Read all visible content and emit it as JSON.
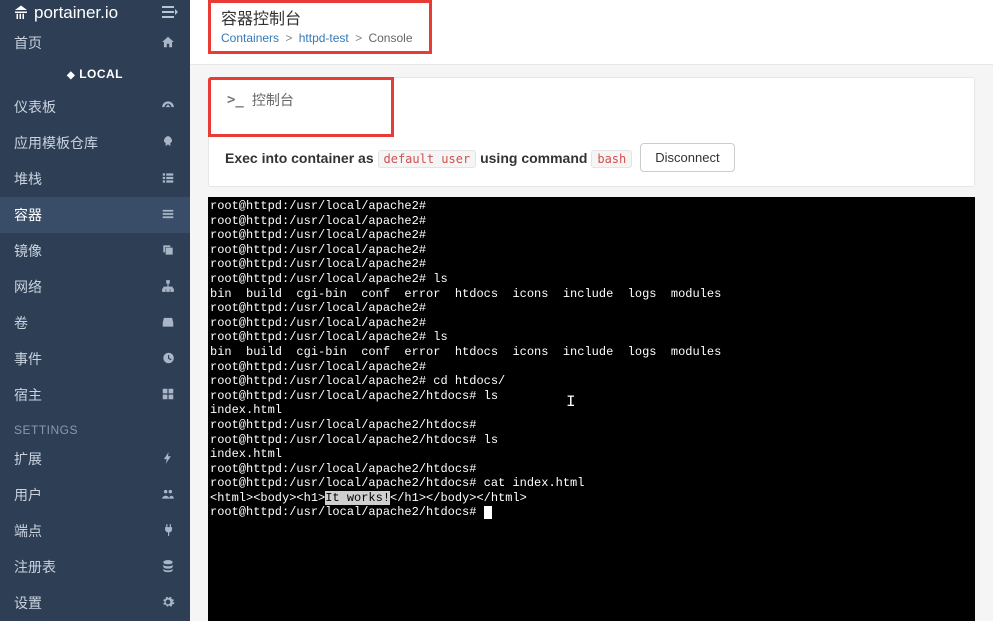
{
  "brand": "portainer.io",
  "env_label": "LOCAL",
  "settings_heading": "SETTINGS",
  "sidebar": {
    "home": "首页",
    "items_top": [
      {
        "label": "仪表板",
        "icon": "tachometer"
      },
      {
        "label": "应用模板仓库",
        "icon": "rocket"
      },
      {
        "label": "堆栈",
        "icon": "th-list"
      },
      {
        "label": "容器",
        "icon": "bars",
        "active": true
      },
      {
        "label": "镜像",
        "icon": "clone"
      },
      {
        "label": "网络",
        "icon": "sitemap"
      },
      {
        "label": "卷",
        "icon": "hdd"
      },
      {
        "label": "事件",
        "icon": "history"
      },
      {
        "label": "宿主",
        "icon": "th"
      }
    ],
    "items_settings": [
      {
        "label": "扩展",
        "icon": "bolt"
      },
      {
        "label": "用户",
        "icon": "users"
      },
      {
        "label": "端点",
        "icon": "plug"
      },
      {
        "label": "注册表",
        "icon": "database"
      },
      {
        "label": "设置",
        "icon": "cog"
      }
    ]
  },
  "header": {
    "title": "容器控制台",
    "crumbs": {
      "a": "Containers",
      "b": "httpd-test",
      "c": "Console"
    }
  },
  "panel": {
    "head": "控制台",
    "exec_pre": "Exec into container as",
    "exec_user": "default user",
    "exec_mid": "using command",
    "exec_cmd": "bash",
    "disconnect": "Disconnect"
  },
  "terminal_lines": [
    "root@httpd:/usr/local/apache2#",
    "root@httpd:/usr/local/apache2#",
    "root@httpd:/usr/local/apache2#",
    "root@httpd:/usr/local/apache2#",
    "root@httpd:/usr/local/apache2#",
    "root@httpd:/usr/local/apache2# ls",
    "bin  build  cgi-bin  conf  error  htdocs  icons  include  logs  modules",
    "root@httpd:/usr/local/apache2#",
    "root@httpd:/usr/local/apache2#",
    "root@httpd:/usr/local/apache2# ls",
    "bin  build  cgi-bin  conf  error  htdocs  icons  include  logs  modules",
    "root@httpd:/usr/local/apache2#",
    "root@httpd:/usr/local/apache2# cd htdocs/",
    "root@httpd:/usr/local/apache2/htdocs# ls",
    "index.html",
    "root@httpd:/usr/local/apache2/htdocs#",
    "root@httpd:/usr/local/apache2/htdocs# ls",
    "index.html",
    "root@httpd:/usr/local/apache2/htdocs#",
    "root@httpd:/usr/local/apache2/htdocs# cat index.html"
  ],
  "terminal_html_line": {
    "pre": "<html><body><h1>",
    "hl": "It works!",
    "post": "</h1></body></html>"
  },
  "terminal_prompt_last": "root@httpd:/usr/local/apache2/htdocs# "
}
